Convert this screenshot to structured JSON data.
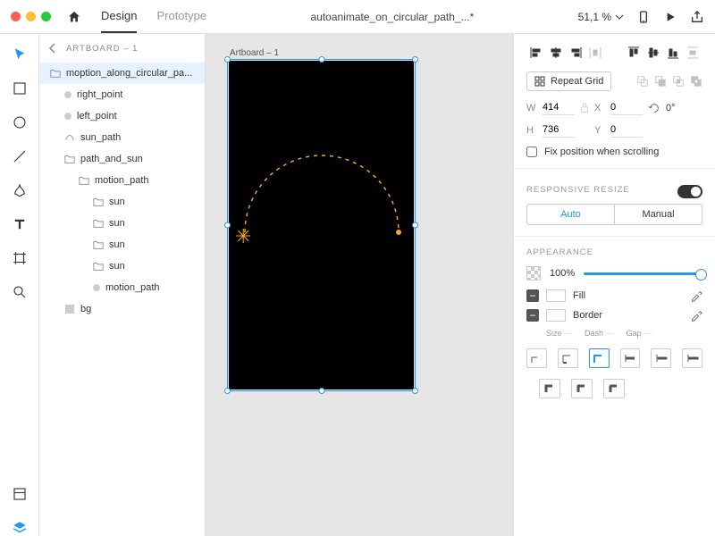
{
  "titlebar": {
    "tabs": {
      "design": "Design",
      "prototype": "Prototype"
    },
    "document": "autoanimate_on_circular_path_...*",
    "zoom": "51,1 %"
  },
  "layers": {
    "breadcrumb": "ARTBOARD – 1",
    "items": [
      {
        "label": "moption_along_circular_pa...",
        "type": "folder",
        "depth": 0,
        "sel": true
      },
      {
        "label": "right_point",
        "type": "dot",
        "depth": 1
      },
      {
        "label": "left_point",
        "type": "dot",
        "depth": 1
      },
      {
        "label": "sun_path",
        "type": "path",
        "depth": 1
      },
      {
        "label": "path_and_sun",
        "type": "folder",
        "depth": 1
      },
      {
        "label": "motion_path",
        "type": "folder",
        "depth": 2
      },
      {
        "label": "sun",
        "type": "folder",
        "depth": 3
      },
      {
        "label": "sun",
        "type": "folder",
        "depth": 3
      },
      {
        "label": "sun",
        "type": "folder",
        "depth": 3
      },
      {
        "label": "sun",
        "type": "folder",
        "depth": 3
      },
      {
        "label": "motion_path",
        "type": "dot",
        "depth": 3
      },
      {
        "label": "bg",
        "type": "rect",
        "depth": 1
      }
    ]
  },
  "canvas": {
    "artboard_label": "Artboard – 1"
  },
  "props": {
    "repeat_grid": "Repeat Grid",
    "w": "414",
    "h": "736",
    "x": "0",
    "y": "0",
    "rot": "0°",
    "fix_scroll": "Fix position when scrolling",
    "responsive": "RESPONSIVE RESIZE",
    "auto": "Auto",
    "manual": "Manual",
    "appearance": "APPEARANCE",
    "opacity": "100%",
    "fill": "Fill",
    "border": "Border",
    "size": "Size",
    "dash": "Dash",
    "gap": "Gap",
    "w_label": "W",
    "h_label": "H",
    "x_label": "X",
    "y_label": "Y"
  }
}
